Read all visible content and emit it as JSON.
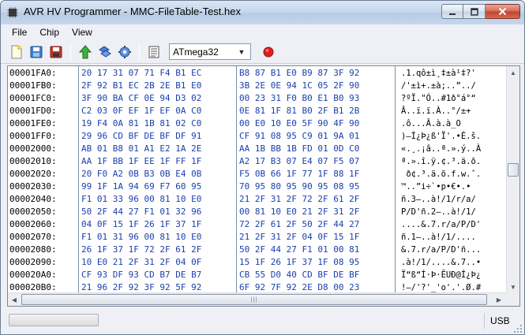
{
  "window": {
    "title": "AVR HV Programmer - MMC-FileTable-Test.hex"
  },
  "menu": [
    "File",
    "Chip",
    "View"
  ],
  "toolbar": {
    "icons": [
      "new-file-icon",
      "open-file-icon",
      "save-icon",
      "upload-arrow-icon",
      "transfer-icon",
      "settings-gear-icon",
      "document-list-icon",
      "record-icon"
    ],
    "chip_selected": "ATmega32"
  },
  "hex": {
    "rows": [
      {
        "addr": "00001FA0:",
        "hex1": "20 17 31 07 71 F4 B1 EC",
        "hex2": "B8 87 B1 E0 B9 87 3F 92",
        "ascii": ".1.qô±ì¸‡±à¹‡?'"
      },
      {
        "addr": "00001FB0:",
        "hex1": "2F 92 B1 EC 2B 2E B1 E0",
        "hex2": "3B 2E 0E 94 1C 05 2F 90",
        "ascii": "/'±ì+.±à;..”../"
      },
      {
        "addr": "00001FC0:",
        "hex1": "3F 90 BA CF 0E 94 D3 02",
        "hex2": "00 23 31 F0 B0 E1 B0 93",
        "ascii": "?ºÏ.\"Ó..#1ð°á°“"
      },
      {
        "addr": "00001FD0:",
        "hex1": "C2 03 0F EF 1F EF 0A C0",
        "hex2": "0E 81 1F 81 B0 2F B1 2B",
        "ascii": "Â..ï.ï.À..°/±+"
      },
      {
        "addr": "00001FE0:",
        "hex1": "19 F4 0A 81 1B 81 02 C0",
        "hex2": "00 E0 10 E0 5F 90 4F 90",
        "ascii": ".ô...Â.à.à_O"
      },
      {
        "addr": "00001FF0:",
        "hex1": "29 96 CD BF DE BF DF 91",
        "hex2": "CF 91 08 95 C9 01 9A 01",
        "ascii": ")–Í¿Þ¿ß'Ï'.•É.š."
      },
      {
        "addr": "00002000:",
        "hex1": "AB 01 B8 01 A1 E2 1A 2E",
        "hex2": "AA 1B BB 1B FD 01 0D C0",
        "ascii": "«.¸.¡â..ª.».ý..À"
      },
      {
        "addr": "00002010:",
        "hex1": "AA 1F BB 1F EE 1F FF 1F",
        "hex2": "A2 17 B3 07 E4 07 F5 07",
        "ascii": "ª.».î.ÿ.¢.³.ä.õ."
      },
      {
        "addr": "00002020:",
        "hex1": "20 F0 A2 0B B3 0B E4 0B",
        "hex2": "F5 0B 66 1F 77 1F 88 1F",
        "ascii": " ð¢.³.ä.õ.f.w.ˆ."
      },
      {
        "addr": "00002030:",
        "hex1": "99 1F 1A 94 69 F7 60 95",
        "hex2": "70 95 80 95 90 95 08 95",
        "ascii": "™..”i÷`•p•€•.•"
      },
      {
        "addr": "00002040:",
        "hex1": "F1 01 33 96 00 81 10 E0",
        "hex2": "21 2F 31 2F 72 2F 61 2F",
        "ascii": "ñ.3–..à!/1/r/a/"
      },
      {
        "addr": "00002050:",
        "hex1": "50 2F 44 27 F1 01 32 96",
        "hex2": "00 81 10 E0 21 2F 31 2F",
        "ascii": "P/D'ñ.2–..à!/1/"
      },
      {
        "addr": "00002060:",
        "hex1": "04 0F 15 1F 26 1F 37 1F",
        "hex2": "72 2F 61 2F 50 2F 44 27",
        "ascii": "....&.7.r/a/P/D'"
      },
      {
        "addr": "00002070:",
        "hex1": "F1 01 31 96 00 81 10 E0",
        "hex2": "21 2F 31 2F 04 0F 15 1F",
        "ascii": "ñ.1–..à!/1/...."
      },
      {
        "addr": "00002080:",
        "hex1": "26 1F 37 1F 72 2F 61 2F",
        "hex2": "50 2F 44 27 F1 01 00 81",
        "ascii": "&.7.r/a/P/D'ñ..."
      },
      {
        "addr": "00002090:",
        "hex1": "10 E0 21 2F 31 2F 04 0F",
        "hex2": "15 1F 26 1F 37 1F 08 95",
        "ascii": ".à!/1/....&.7..•"
      },
      {
        "addr": "000020A0:",
        "hex1": "CF 93 DF 93 CD B7 DE B7",
        "hex2": "CB 55 D0 40 CD BF DE BF",
        "ascii": "Ï“ß“Í·Þ·ËUÐ@Í¿Þ¿"
      },
      {
        "addr": "000020B0:",
        "hex1": "21 96 2F 92 3F 92 5F 92",
        "hex2": "6F 92 7F 92 2E D8 00 23",
        "ascii": "!–/'?'_'o'.'.Ø.#"
      }
    ]
  },
  "status": {
    "progress": 0,
    "message": "",
    "connection": "USB"
  }
}
